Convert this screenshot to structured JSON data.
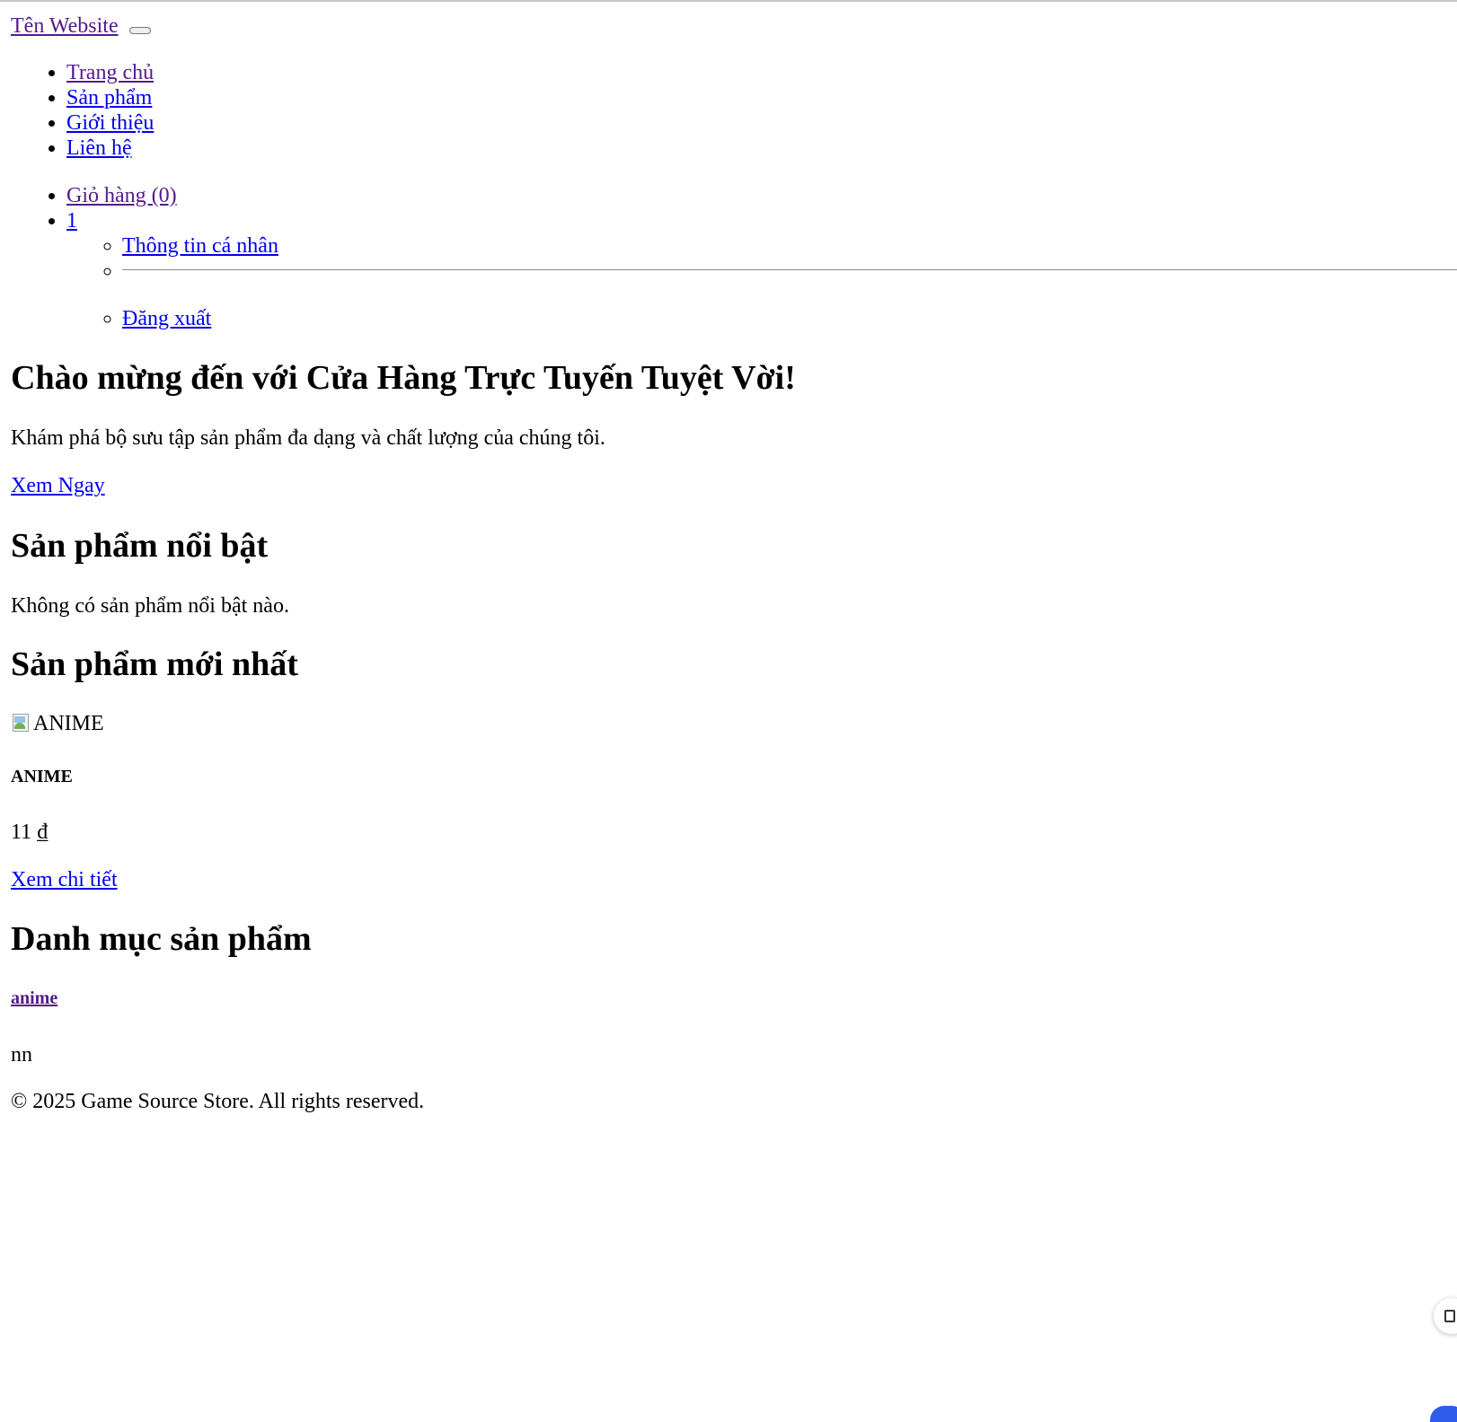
{
  "navbar": {
    "brand": "Tên Website",
    "toggler_label": ""
  },
  "main_nav": {
    "items": [
      {
        "label": "Trang chủ"
      },
      {
        "label": "Sản phẩm"
      },
      {
        "label": "Giới thiệu"
      },
      {
        "label": "Liên hệ"
      }
    ]
  },
  "user_nav": {
    "cart_label": "Giỏ hàng (0)",
    "user_label": "1",
    "dropdown": {
      "profile_label": "Thông tin cá nhân",
      "logout_label": "Đăng xuất"
    }
  },
  "hero": {
    "title": "Chào mừng đến với Cửa Hàng Trực Tuyến Tuyệt Vời!",
    "subtitle": "Khám phá bộ sưu tập sản phẩm đa dạng và chất lượng của chúng tôi.",
    "cta_label": "Xem Ngay"
  },
  "featured": {
    "title": "Sản phẩm nổi bật",
    "empty_text": "Không có sản phẩm nổi bật nào."
  },
  "newest": {
    "title": "Sản phẩm mới nhất",
    "products": [
      {
        "image_alt": "ANIME",
        "name": "ANIME",
        "price": "11 ₫",
        "detail_label": "Xem chi tiết"
      }
    ]
  },
  "categories": {
    "title": "Danh mục sản phẩm",
    "items": [
      {
        "name": "anime",
        "description": "nn"
      }
    ]
  },
  "footer": {
    "copyright": "© 2025 Game Source Store. All rights reserved."
  },
  "colors": {
    "link": "#0000ee",
    "visited_link": "#551a8b",
    "text": "#000000",
    "background": "#ffffff",
    "widget_accent": "#2f5bea"
  }
}
